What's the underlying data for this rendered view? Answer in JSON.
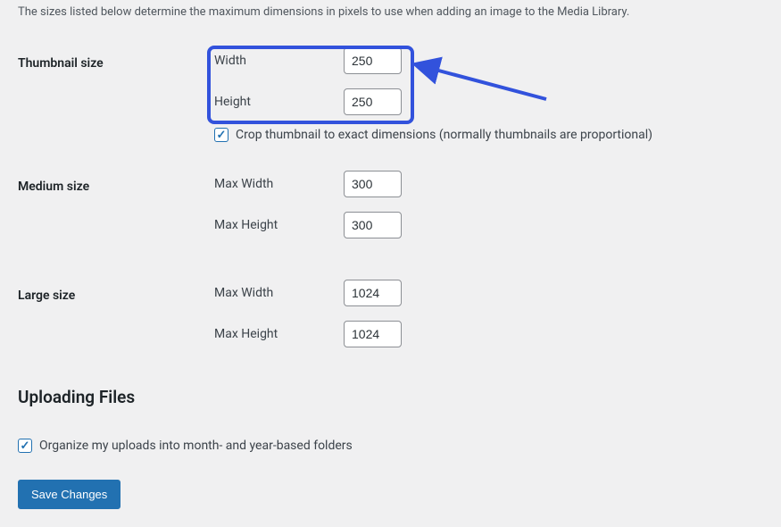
{
  "description": "The sizes listed below determine the maximum dimensions in pixels to use when adding an image to the Media Library.",
  "thumbnail": {
    "section_label": "Thumbnail size",
    "width_label": "Width",
    "width_value": "250",
    "height_label": "Height",
    "height_value": "250",
    "crop_label": "Crop thumbnail to exact dimensions (normally thumbnails are proportional)",
    "crop_checked": true
  },
  "medium": {
    "section_label": "Medium size",
    "max_width_label": "Max Width",
    "max_width_value": "300",
    "max_height_label": "Max Height",
    "max_height_value": "300"
  },
  "large": {
    "section_label": "Large size",
    "max_width_label": "Max Width",
    "max_width_value": "1024",
    "max_height_label": "Max Height",
    "max_height_value": "1024"
  },
  "uploading": {
    "heading": "Uploading Files",
    "organize_label": "Organize my uploads into month- and year-based folders",
    "organize_checked": true
  },
  "save_label": "Save Changes",
  "annotation": {
    "highlight_color": "#3252dc"
  }
}
